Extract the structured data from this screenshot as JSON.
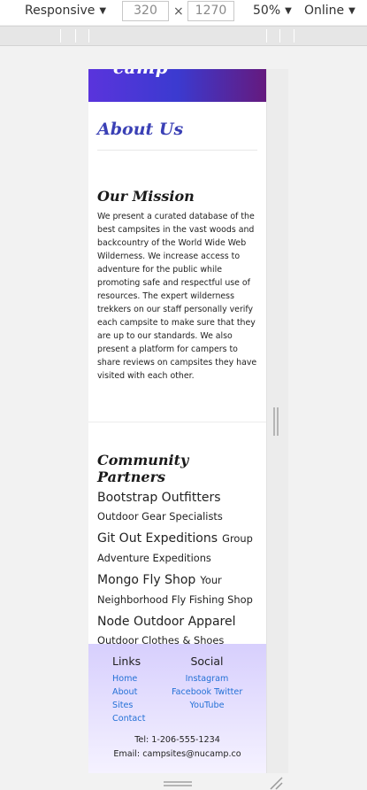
{
  "devtools": {
    "device_label": "Responsive",
    "width_value": "320",
    "times": "×",
    "height_value": "1270",
    "zoom_label": "50%",
    "network_label": "Online"
  },
  "site": {
    "logo_text": "camp",
    "about_title": "About Us",
    "mission": {
      "title": "Our Mission",
      "text": "We present a curated database of the best campsites in the vast woods and backcountry of the World Wide Web Wilderness. We increase access to adventure for the public while promoting safe and respectful use of resources. The expert wilderness trekkers on our staff personally verify each campsite to make sure that they are up to our standards. We also present a platform for campers to share reviews on campsites they have visited with each other."
    },
    "partners": {
      "title": "Community Partners",
      "items": [
        {
          "name": "Bootstrap Outfitters",
          "desc": "Outdoor Gear Specialists"
        },
        {
          "name": "Git Out Expeditions",
          "desc": "Group Adventure Expeditions"
        },
        {
          "name": "Mongo Fly Shop",
          "desc": "Your Neighborhood Fly Fishing Shop"
        },
        {
          "name": "Node Outdoor Apparel",
          "desc": "Outdoor Clothes & Shoes"
        }
      ]
    },
    "footer": {
      "links_title": "Links",
      "links": [
        "Home",
        "About",
        "Sites",
        "Contact"
      ],
      "social_title": "Social",
      "social": [
        "Instagram",
        "Facebook Twitter",
        "YouTube"
      ],
      "tel": "Tel: 1-206-555-1234",
      "email": "Email: campsites@nucamp.co"
    }
  }
}
